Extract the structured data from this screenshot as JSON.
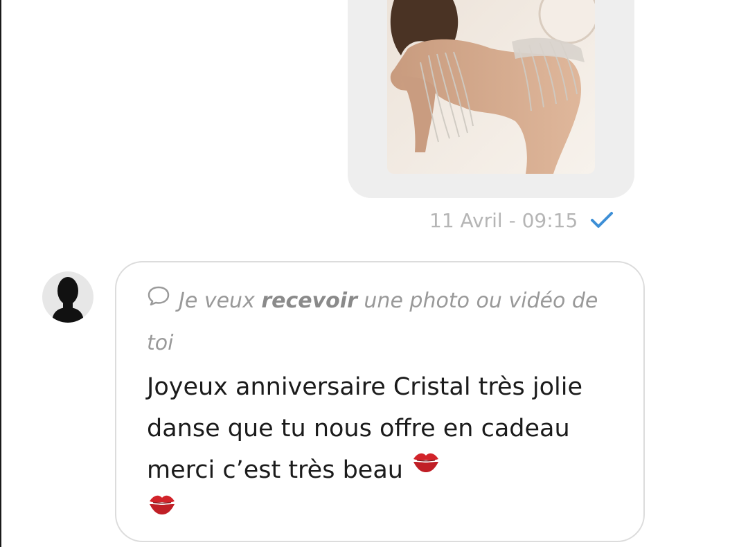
{
  "outgoing": {
    "media": {
      "kind": "photo"
    },
    "timestamp": "11 Avril - 09:15",
    "status_icon": "check-icon"
  },
  "incoming": {
    "avatar_icon": "person-silhouette-icon",
    "request": {
      "icon": "speech-bubble-icon",
      "prefix": "Je veux ",
      "emphasis": "recevoir",
      "suffix": " une photo ou vidéo de toi"
    },
    "message": "Joyeux anniversaire Cristal très jolie danse que tu nous offre en cadeau merci c’est très beau",
    "emojis": [
      "💋",
      "💋"
    ]
  },
  "colors": {
    "bubble_gray": "#eeeeee",
    "border_gray": "#dcdcdc",
    "timestamp": "#b5b5b5",
    "check_blue": "#3d8fd6",
    "kiss_red": "#d2232a"
  }
}
